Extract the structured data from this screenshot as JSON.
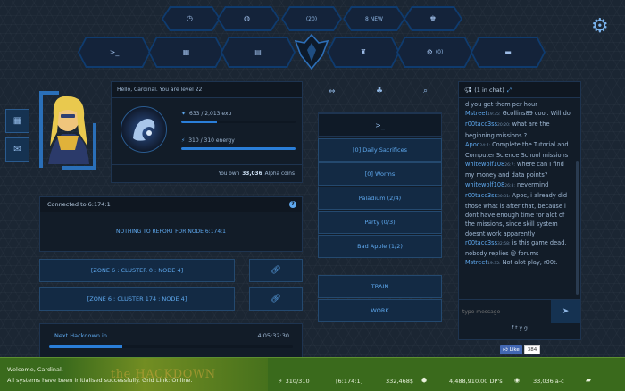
{
  "top_nav_row1": [
    {
      "label": "",
      "icon": "clock-icon"
    },
    {
      "label": "",
      "icon": "globe-icon"
    },
    {
      "label": "(20)",
      "icon": ""
    },
    {
      "label": "8 NEW",
      "icon": ""
    },
    {
      "label": "",
      "icon": "award-icon"
    }
  ],
  "top_nav_row2": [
    {
      "label": "",
      "icon": "terminal-icon"
    },
    {
      "label": "",
      "icon": "grid-icon"
    },
    {
      "label": "",
      "icon": "database-icon"
    },
    {
      "label": "",
      "icon": "robot-icon"
    },
    {
      "label": "(0)",
      "icon": "settings-icon"
    },
    {
      "label": "",
      "icon": "briefcase-icon"
    }
  ],
  "profile": {
    "greeting": "Hello, Cardinal. You are level 22",
    "exp_text": "633 / 2,013 exp",
    "exp_fraction": 0.31,
    "energy_text": "310 / 310 energy",
    "energy_fraction": 1.0,
    "coins_prefix": "You own",
    "coins_value": "33,036",
    "coins_suffix": "Alpha coins"
  },
  "connection": {
    "title": "Connected to 6:174:1",
    "node_report": "NOTHING TO REPORT FOR NODE 6:174:1"
  },
  "zones": [
    {
      "label": "[ZONE 6 : CLUSTER 0 : NODE 4]"
    },
    {
      "label": "[ZONE 6 : CLUSTER 174 : NODE 4]"
    }
  ],
  "hackdown": {
    "label": "Next Hackdown in",
    "time": "4:05:32:30",
    "progress_fraction": 0.3
  },
  "middle_menu": {
    "items": [
      {
        "label": "[0] Daily Sacrifices"
      },
      {
        "label": "[0] Worms"
      },
      {
        "label": "Paladium (2/4)"
      },
      {
        "label": "Party (0/3)"
      },
      {
        "label": "Bad Apple (1/2)"
      }
    ],
    "train_label": "TRAIN",
    "work_label": "WORK"
  },
  "chat": {
    "header": "(1 in chat)",
    "lines": [
      {
        "user": "",
        "time": "",
        "text": "d you get them per hour"
      },
      {
        "user": "Mstreet",
        "time": "19:35:",
        "text": " Gcollins89 cool. Will do"
      },
      {
        "user": "r00tacc3ss",
        "time": "20:20:",
        "text": " what are the beginning missions ?"
      },
      {
        "user": "Apoc",
        "time": "24:7:",
        "text": " Complete the Tutorial and Computer Science School missions"
      },
      {
        "user": "whitewolf108",
        "time": "26:7:",
        "text": " where can I find my money and data points?"
      },
      {
        "user": "whitewolf108",
        "time": "26:8:",
        "text": " nevermind"
      },
      {
        "user": "r00tacc3ss",
        "time": "30:31:",
        "text": " Apoc, i already did those what is after that, because i dont have enough time for alot of the missions, since skill system doesnt work apparently"
      },
      {
        "user": "r00tacc3ss",
        "time": "32:58:",
        "text": " is this game dead, nobody replies @ forums"
      },
      {
        "user": "Mstreet",
        "time": "19:35:",
        "text": " Not alot play, r00t."
      }
    ],
    "input_placeholder": "type message",
    "social_icons": [
      "f",
      "t",
      "y",
      "g"
    ],
    "like_label": "Like",
    "like_count": "384"
  },
  "status_bar": {
    "welcome": "Welcome, Cardinal.",
    "message": "All systems have been initialised successfully. Grid Link: Online.",
    "logo_text": "the HACKDOWN",
    "energy": "310/310",
    "node": "[6:174:1]",
    "money": "332,468$",
    "dp": "4,488,910.00 DP's",
    "coins": "33,036 a-c"
  },
  "colors": {
    "accent": "#5ea8ee",
    "panel": "#121c28",
    "statusbar": "#3c6b1f"
  }
}
